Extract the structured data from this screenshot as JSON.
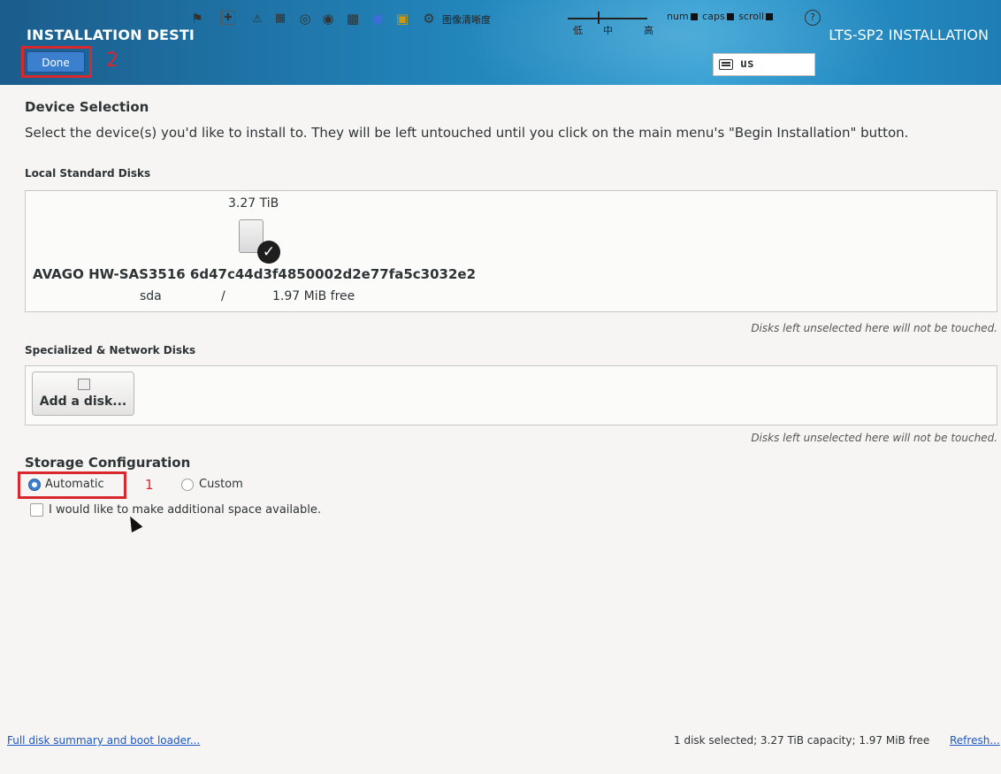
{
  "header": {
    "title": "INSTALLATION DESTI",
    "right_title": "LTS-SP2 INSTALLATION",
    "done_label": "Done",
    "annotation_done": "2",
    "keyboard_layout": "us"
  },
  "toolbar": {
    "icons": [
      "pin-icon",
      "move-icon",
      "warning-icon",
      "screen-icon",
      "target-icon",
      "disc-icon",
      "drive-icon",
      "cd-icon",
      "tiles-icon",
      "settings-icon"
    ],
    "clarity_label": "图像清晰度",
    "levels": {
      "low": "低",
      "mid": "中",
      "high": "高"
    },
    "clarity_level": "中",
    "num": "num",
    "caps": "caps",
    "scroll": "scroll",
    "help": "?"
  },
  "device_selection": {
    "title": "Device Selection",
    "description": "Select the device(s) you'd like to install to.  They will be left untouched until you click on the main menu's \"Begin Installation\" button."
  },
  "local_disks": {
    "title": "Local Standard Disks",
    "disk": {
      "size": "3.27 TiB",
      "name": "AVAGO HW-SAS3516 6d47c44d3f4850002d2e77fa5c3032e2",
      "device": "sda",
      "mount": "/",
      "free": "1.97 MiB free",
      "selected": true
    },
    "hint": "Disks left unselected here will not be touched."
  },
  "network_disks": {
    "title": "Specialized & Network Disks",
    "add_label": "Add a disk...",
    "hint": "Disks left unselected here will not be touched."
  },
  "storage": {
    "title": "Storage Configuration",
    "automatic": "Automatic",
    "custom": "Custom",
    "annotation_auto": "1",
    "selected": "Automatic",
    "additional_space": "I would like to make additional space available.",
    "additional_space_checked": false
  },
  "footer": {
    "summary_link": "Full disk summary and boot loader...",
    "status": "1 disk selected; 3.27 TiB capacity; 1.97 MiB free",
    "refresh": "Refresh..."
  },
  "colors": {
    "header_blue": "#2180b5",
    "annotation_red": "#d9272e",
    "accent_blue": "#3d7fcf",
    "link_blue": "#1a57c9"
  }
}
